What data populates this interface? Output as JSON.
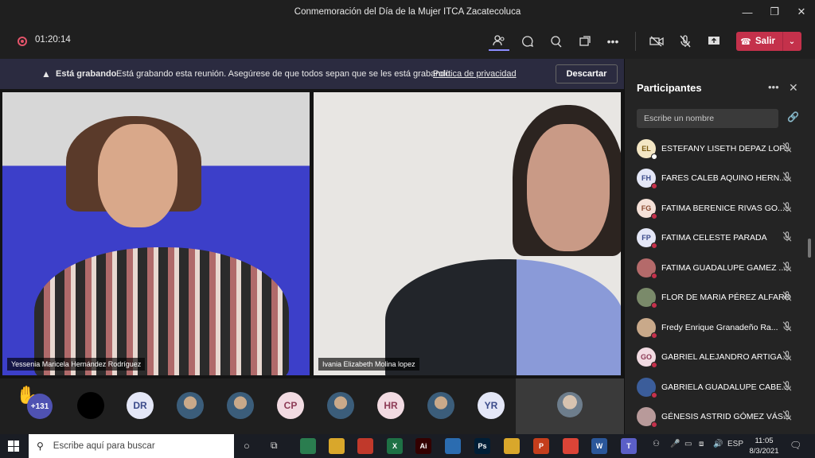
{
  "window": {
    "title": "Conmemoración del Día de la Mujer ITCA Zacatecoluca",
    "minimize": "—",
    "maximize": "❐",
    "close": "✕"
  },
  "toolbar": {
    "timer": "01:20:14",
    "leave_label": "Salir",
    "icons": [
      "participants-icon",
      "chat-icon",
      "reactions-icon",
      "share-tray-icon",
      "more-icon",
      "camera-off-icon",
      "mic-off-icon",
      "share-icon"
    ]
  },
  "banner": {
    "title": "Está grabando",
    "message": "Está grabando esta reunión. Asegúrese de que todos sepan que se les está grabando.",
    "link": "Política de privacidad",
    "discard": "Descartar"
  },
  "videos": [
    {
      "name": "Yessenia Maricela Hernández Rodríguez"
    },
    {
      "name": "Ivania Elizabeth Molina lopez"
    }
  ],
  "strip": {
    "overflow_count": "+131",
    "avatars": [
      {
        "initials": "",
        "style": "dark"
      },
      {
        "initials": "DR",
        "style": "initial"
      },
      {
        "initials": "",
        "style": "photo"
      },
      {
        "initials": "",
        "style": "photo"
      },
      {
        "initials": "CP",
        "style": "pink"
      },
      {
        "initials": "",
        "style": "photo"
      },
      {
        "initials": "HR",
        "style": "pink"
      },
      {
        "initials": "",
        "style": "photo"
      },
      {
        "initials": "YR",
        "style": "initial"
      }
    ]
  },
  "panel": {
    "title": "Participantes",
    "search_placeholder": "Escribe un nombre",
    "participants": [
      {
        "initials": "EL",
        "name": "ESTEFANY LISETH DEPAZ LOP...",
        "color": "#f3e6c4",
        "text": "#7a5a10"
      },
      {
        "initials": "FH",
        "name": "FARES CALEB AQUINO HERN...",
        "color": "#e4e7f7",
        "text": "#3a4a8a"
      },
      {
        "initials": "FG",
        "name": "FATIMA BERENICE RIVAS GO...",
        "color": "#f5e1d8",
        "text": "#8a4a30"
      },
      {
        "initials": "FP",
        "name": "FATIMA CELESTE PARADA",
        "color": "#e4e7f7",
        "text": "#3a4a8a"
      },
      {
        "initials": "",
        "name": "FATIMA GUADALUPE GAMEZ ...",
        "color": "#b46a6a",
        "text": "#fff"
      },
      {
        "initials": "",
        "name": "FLOR DE MARIA PÉREZ ALFARO",
        "color": "#7a8a6a",
        "text": "#fff"
      },
      {
        "initials": "",
        "name": "Fredy Enrique Granadeño Ra...",
        "color": "#c9a98a",
        "text": "#fff"
      },
      {
        "initials": "GO",
        "name": "GABRIEL ALEJANDRO ARTIGA...",
        "color": "#f2dbe2",
        "text": "#8c3a55"
      },
      {
        "initials": "",
        "name": "GABRIELA GUADALUPE CABE...",
        "color": "#3b5d9a",
        "text": "#fff"
      },
      {
        "initials": "",
        "name": "GÉNESIS ASTRID GÓMEZ VÁS...",
        "color": "#b89a9a",
        "text": "#fff"
      }
    ]
  },
  "taskbar": {
    "search_placeholder": "Escribe aquí para buscar",
    "lang": "ESP",
    "time": "11:05",
    "date": "8/3/2021",
    "apps": [
      {
        "label": "",
        "color": "#2a7d4f"
      },
      {
        "label": "",
        "color": "#d9a72b"
      },
      {
        "label": "",
        "color": "#c0392b"
      },
      {
        "label": "X",
        "color": "#1e7145"
      },
      {
        "label": "Ai",
        "color": "#330000"
      },
      {
        "label": "",
        "color": "#2b6cb0"
      },
      {
        "label": "Ps",
        "color": "#001e36"
      },
      {
        "label": "",
        "color": "#d9a72b"
      },
      {
        "label": "P",
        "color": "#c43e1c"
      },
      {
        "label": "",
        "color": "#db4437"
      },
      {
        "label": "W",
        "color": "#2b579a"
      },
      {
        "label": "T",
        "color": "#5b5fc7"
      }
    ]
  }
}
